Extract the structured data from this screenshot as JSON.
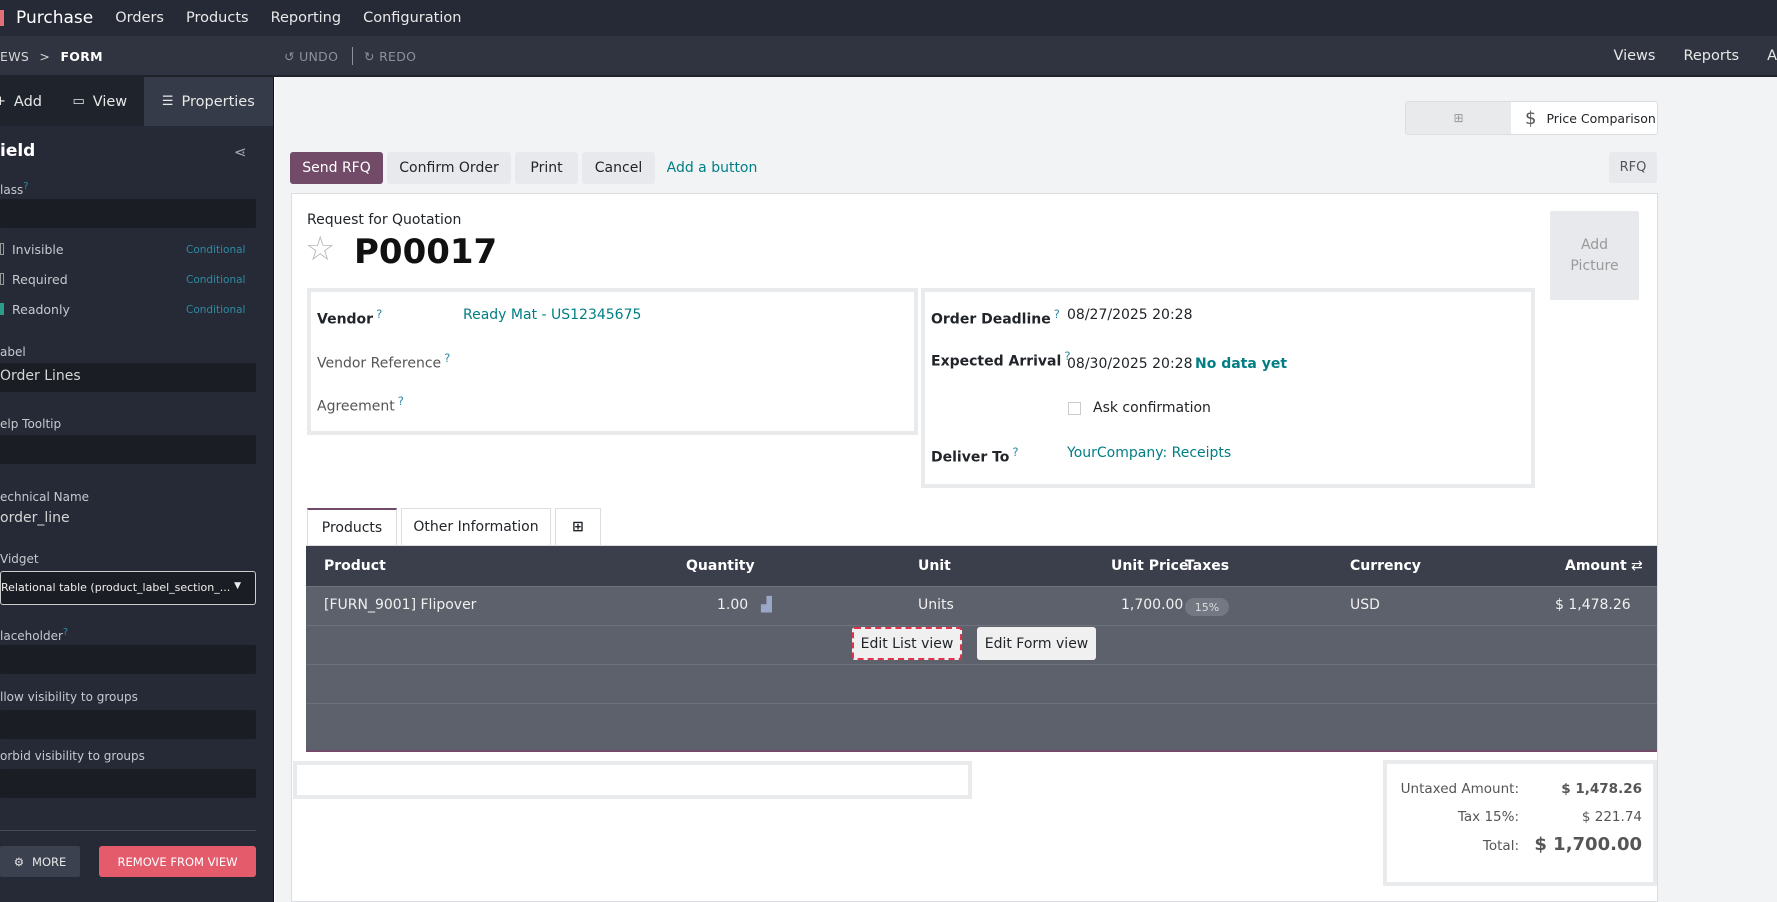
{
  "topnav": {
    "app": "Purchase",
    "menus": [
      "Orders",
      "Products",
      "Reporting",
      "Configuration"
    ]
  },
  "studiobar": {
    "breadcrumb_prev": "EWS",
    "breadcrumb_sep": ">",
    "breadcrumb_current": "FORM",
    "undo": "UNDO",
    "redo": "REDO",
    "right_links": [
      "Views",
      "Reports",
      "A"
    ]
  },
  "sidebar": {
    "tabs": [
      {
        "label": "Add",
        "icon": "plus-icon"
      },
      {
        "label": "View",
        "icon": "monitor-icon"
      },
      {
        "label": "Properties",
        "icon": "list-icon"
      }
    ],
    "title": "ield",
    "class_label": "lass",
    "invisible_label": "Invisible",
    "required_label": "Required",
    "readonly_label": "Readonly",
    "conditional": "Conditional",
    "label_label": "abel",
    "label_value": "Order Lines",
    "help_label": "elp Tooltip",
    "tech_label": "echnical Name",
    "tech_value": "order_line",
    "widget_label": "Vidget",
    "widget_value": "Relational table (product_label_section_...",
    "placeholder_label": "laceholder",
    "allow_groups_label": "llow visibility to groups",
    "forbid_groups_label": "orbid visibility to groups",
    "more": "MORE",
    "remove": "REMOVE FROM VIEW"
  },
  "control_panel": {
    "price_comparison": "Price Comparison"
  },
  "header_buttons": {
    "send_rfq": "Send RFQ",
    "confirm": "Confirm Order",
    "print": "Print",
    "cancel": "Cancel",
    "add_button": "Add a button",
    "status": "RFQ"
  },
  "form": {
    "subtitle": "Request for Quotation",
    "name": "P00017",
    "add_picture_1": "Add",
    "add_picture_2": "Picture",
    "help": "?",
    "vendor_label": "Vendor",
    "vendor_value": "Ready Mat - US12345675",
    "vendor_ref_label": "Vendor Reference",
    "agreement_label": "Agreement",
    "deadline_label": "Order Deadline",
    "deadline_value": "08/27/2025 20:28",
    "arrival_label": "Expected Arrival",
    "arrival_value": "08/30/2025 20:28",
    "no_data": "No data yet",
    "ask_confirmation": "Ask confirmation",
    "deliver_label": "Deliver To",
    "deliver_value": "YourCompany: Receipts"
  },
  "tabs": [
    "Products",
    "Other Information"
  ],
  "table": {
    "headers": [
      "Product",
      "Quantity",
      "Unit",
      "Unit Price",
      "Taxes",
      "Currency",
      "Amount"
    ],
    "row": {
      "product": "[FURN_9001] Flipover",
      "quantity": "1.00",
      "unit": "Units",
      "unit_price": "1,700.00",
      "taxes": "15%",
      "currency": "USD",
      "amount": "$ 1,478.26"
    },
    "edit_list": "Edit List view",
    "edit_form": "Edit Form view"
  },
  "totals": {
    "untaxed_label": "Untaxed Amount:",
    "untaxed_value": "$ 1,478.26",
    "tax_label": "Tax 15%:",
    "tax_value": "$ 221.74",
    "total_label": "Total:",
    "total_value": "$ 1,700.00"
  }
}
